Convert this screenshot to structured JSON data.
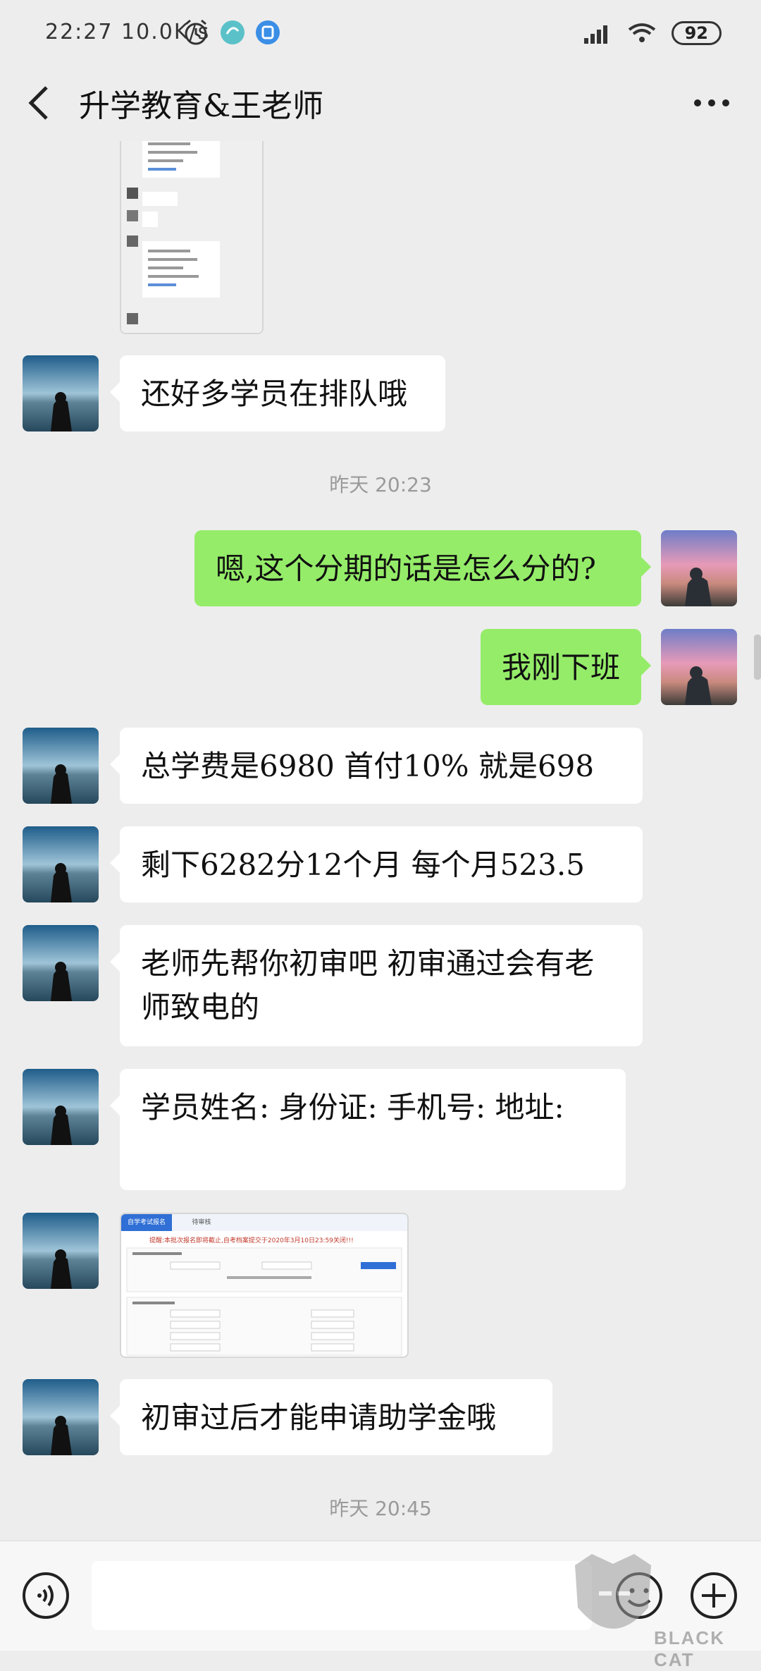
{
  "status": {
    "time": "22:27",
    "speed": "10.0K/s",
    "battery": "92"
  },
  "header": {
    "title": "升学教育&王老师"
  },
  "messages": [
    {
      "text": "还好多学员在排队哦"
    },
    {
      "text": "嗯,这个分期的话是怎么分的?"
    },
    {
      "text": "我刚下班"
    },
    {
      "text": "总学费是6980  首付10%  就是698"
    },
    {
      "text": "剩下6282分12个月  每个月523.5"
    },
    {
      "text": "老师先帮你初审吧  初审通过会有老师致电的"
    },
    {
      "text": "学员姓名:  身份证:  手机号:  地址:"
    },
    {
      "text": "初审过后才能申请助学金哦"
    }
  ],
  "timestamps": [
    "昨天 20:23",
    "昨天 20:45"
  ],
  "form_thumb": {
    "tab1": "自学考试报名",
    "tab2": "待审核",
    "notice": "提醒:本批次报名即将截止,自考档案提交于2020年3月10日23:59关闭!!!"
  },
  "watermark": {
    "text": "BLACK CAT"
  },
  "colors": {
    "sent_bubble": "#95ec69",
    "received_bubble": "#ffffff",
    "background": "#ededed"
  },
  "icons": [
    "back-icon",
    "more-icon",
    "voice-icon",
    "emoji-icon",
    "plus-icon",
    "alarm-icon",
    "wifi-icon",
    "signal-icon"
  ]
}
